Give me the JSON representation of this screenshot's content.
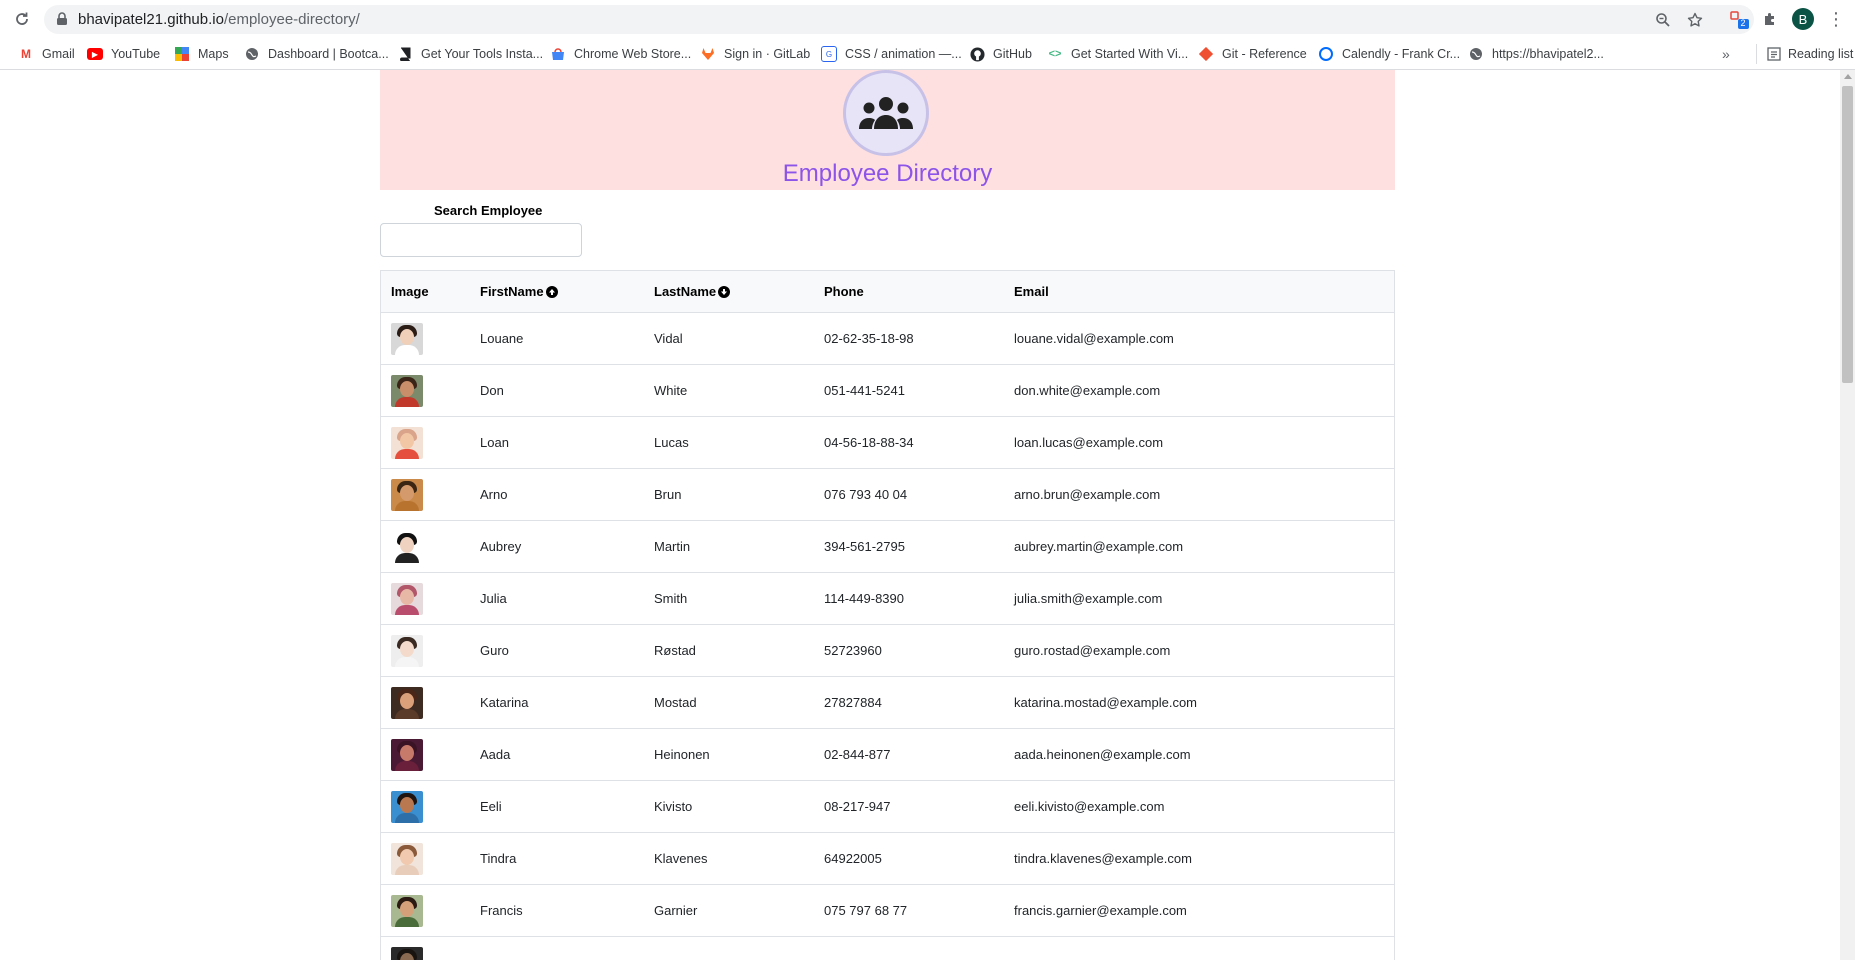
{
  "browser": {
    "url_host": "bhavipatel21.github.io",
    "url_path": "/employee-directory/",
    "profile_initial": "B",
    "extension_badge": "2",
    "bookmarks": [
      {
        "label": "Gmail",
        "icon": "gmail-icon",
        "color": "#ea4335"
      },
      {
        "label": "YouTube",
        "icon": "youtube-icon",
        "color": "#ff0000"
      },
      {
        "label": "Maps",
        "icon": "maps-icon",
        "color": "#34a853"
      },
      {
        "label": "Dashboard | Bootca...",
        "icon": "globe-icon",
        "color": "#5f6368"
      },
      {
        "label": "Get Your Tools Insta...",
        "icon": "book-icon",
        "color": "#202124"
      },
      {
        "label": "Chrome Web Store...",
        "icon": "webstore-icon",
        "color": "#4285f4"
      },
      {
        "label": "Sign in · GitLab",
        "icon": "gitlab-icon",
        "color": "#fc6d26"
      },
      {
        "label": "CSS / animation —...",
        "icon": "css-icon",
        "color": "#2965f1"
      },
      {
        "label": "GitHub",
        "icon": "github-icon",
        "color": "#24292e"
      },
      {
        "label": "Get Started With Vi...",
        "icon": "code-icon",
        "color": "#42b883"
      },
      {
        "label": "Git - Reference",
        "icon": "git-icon",
        "color": "#f05032"
      },
      {
        "label": "Calendly - Frank Cr...",
        "icon": "calendly-icon",
        "color": "#006bff"
      },
      {
        "label": "https://bhavipatel2...",
        "icon": "globe-icon",
        "color": "#5f6368"
      }
    ],
    "more_label": "»",
    "reading_list_label": "Reading list"
  },
  "header": {
    "title": "Employee Directory",
    "background": "#ffe0e0",
    "title_color": "#8c54e8"
  },
  "search": {
    "label": "Search Employee",
    "value": "",
    "placeholder": ""
  },
  "table": {
    "columns": {
      "image": "Image",
      "first": "FirstName",
      "last": "LastName",
      "phone": "Phone",
      "email": "Email"
    },
    "rows": [
      {
        "first": "Louane",
        "last": "Vidal",
        "phone": "02-62-35-18-98",
        "email": "louane.vidal@example.com",
        "skin": "#f0d0b8",
        "hair": "#2b1d16",
        "shirt": "#ffffff",
        "bg": "#d8d8d8"
      },
      {
        "first": "Don",
        "last": "White",
        "phone": "051-441-5241",
        "email": "don.white@example.com",
        "skin": "#c98f6a",
        "hair": "#3a2417",
        "shirt": "#c0392b",
        "bg": "#7a8a6a"
      },
      {
        "first": "Loan",
        "last": "Lucas",
        "phone": "04-56-18-88-34",
        "email": "loan.lucas@example.com",
        "skin": "#f2c7a6",
        "hair": "#d9a48a",
        "shirt": "#e4503d",
        "bg": "#f3e1d6"
      },
      {
        "first": "Arno",
        "last": "Brun",
        "phone": "076 793 40 04",
        "email": "arno.brun@example.com",
        "skin": "#d59a6c",
        "hair": "#3b2614",
        "shirt": "#b8732f",
        "bg": "#c98a4a"
      },
      {
        "first": "Aubrey",
        "last": "Martin",
        "phone": "394-561-2795",
        "email": "aubrey.martin@example.com",
        "skin": "#efd2c0",
        "hair": "#111111",
        "shirt": "#222222",
        "bg": "#ffffff"
      },
      {
        "first": "Julia",
        "last": "Smith",
        "phone": "114-449-8390",
        "email": "julia.smith@example.com",
        "skin": "#e8b8a6",
        "hair": "#b2566a",
        "shirt": "#b94d6e",
        "bg": "#e6dadd"
      },
      {
        "first": "Guro",
        "last": "Røstad",
        "phone": "52723960",
        "email": "guro.rostad@example.com",
        "skin": "#f3dacb",
        "hair": "#3a2a22",
        "shirt": "#f5f5f5",
        "bg": "#eeeeee"
      },
      {
        "first": "Katarina",
        "last": "Mostad",
        "phone": "27827884",
        "email": "katarina.mostad@example.com",
        "skin": "#d9a07a",
        "hair": "#4a2618",
        "shirt": "#5a3a28",
        "bg": "#3d2a20"
      },
      {
        "first": "Aada",
        "last": "Heinonen",
        "phone": "02-844-877",
        "email": "aada.heinonen@example.com",
        "skin": "#c77a6a",
        "hair": "#3a1425",
        "shirt": "#6a1f3a",
        "bg": "#4a1a35"
      },
      {
        "first": "Eeli",
        "last": "Kivisto",
        "phone": "08-217-947",
        "email": "eeli.kivisto@example.com",
        "skin": "#b9784f",
        "hair": "#1f1410",
        "shirt": "#2d6fa8",
        "bg": "#3a8fd0"
      },
      {
        "first": "Tindra",
        "last": "Klavenes",
        "phone": "64922005",
        "email": "tindra.klavenes@example.com",
        "skin": "#f0c9ae",
        "hair": "#8a5a3a",
        "shirt": "#e9cdbb",
        "bg": "#f1e4da"
      },
      {
        "first": "Francis",
        "last": "Garnier",
        "phone": "075 797 68 77",
        "email": "francis.garnier@example.com",
        "skin": "#d4a07a",
        "hair": "#2a1a12",
        "shirt": "#4a6b3a",
        "bg": "#a8b890"
      },
      {
        "first": "",
        "last": "",
        "phone": "",
        "email": "",
        "skin": "#8a6a50",
        "hair": "#1a1410",
        "shirt": "#333333",
        "bg": "#2a2a2a"
      }
    ]
  }
}
